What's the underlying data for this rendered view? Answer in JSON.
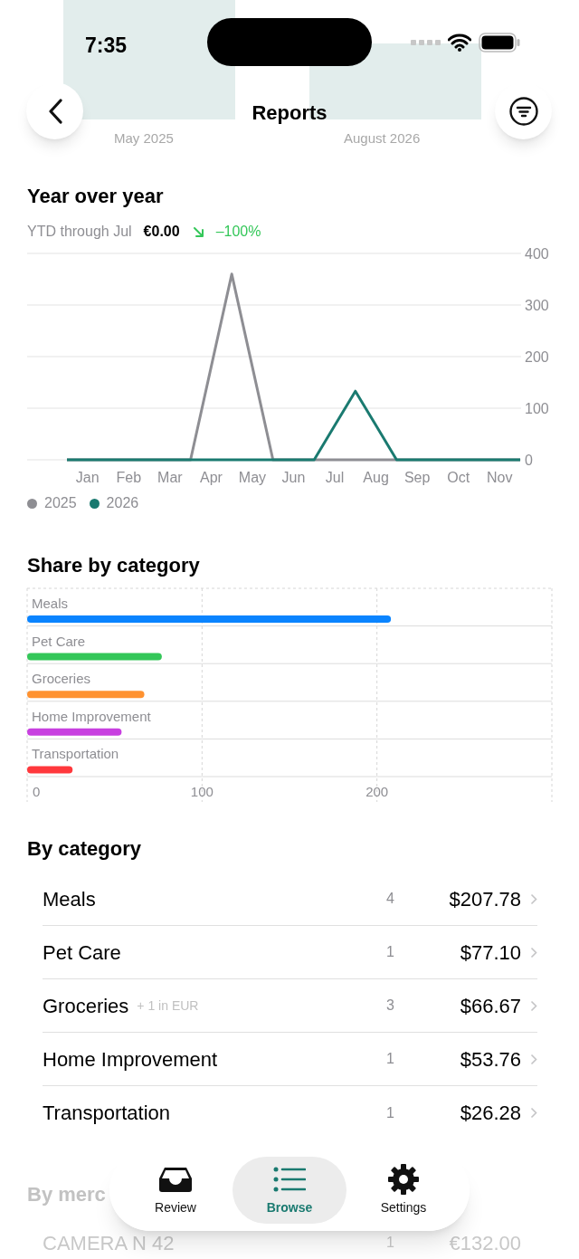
{
  "status_bar": {
    "time": "7:35"
  },
  "background_chart_labels": [
    "May 2025",
    "August 2026"
  ],
  "nav": {
    "title": "Reports"
  },
  "year_over_year": {
    "title": "Year over year",
    "summary_label": "YTD through Jul",
    "summary_value": "€0.00",
    "change": "–100%",
    "chart_data": {
      "type": "line",
      "grid": true,
      "categories": [
        null,
        "Jan",
        null,
        "Feb",
        null,
        "Mar",
        null,
        "Apr",
        null,
        "May",
        null,
        "Jun",
        null,
        "Jul",
        null,
        "Aug",
        null,
        "Sep",
        null,
        "Oct",
        null,
        "Nov",
        null
      ],
      "yticks": [
        0,
        100,
        200,
        300,
        400
      ],
      "ylim": [
        0,
        400
      ],
      "series": [
        {
          "name": "2025",
          "color": "#8e8e93",
          "values": [
            0,
            0,
            0,
            0,
            0,
            0,
            0,
            180,
            360,
            180,
            0,
            0,
            0,
            0,
            0,
            0,
            0,
            0,
            0,
            0,
            0,
            0,
            0
          ]
        },
        {
          "name": "2026",
          "color": "#1a7a70",
          "values": [
            0,
            0,
            0,
            0,
            0,
            0,
            0,
            0,
            0,
            0,
            0,
            0,
            0,
            66.5,
            133,
            66.5,
            0,
            0,
            0,
            0,
            0,
            0,
            0
          ]
        }
      ]
    }
  },
  "share_by_category": {
    "title": "Share by category",
    "chart_data": {
      "type": "bar",
      "orientation": "horizontal",
      "categories": [
        "Meals",
        "Pet Care",
        "Groceries",
        "Home Improvement",
        "Transportation"
      ],
      "xticks": [
        0,
        100,
        200
      ],
      "xlim": [
        0,
        300
      ],
      "series": [
        {
          "color": "#0a84ff",
          "values": [
            208,
            null,
            null,
            null,
            null
          ]
        },
        {
          "color": "#34c759",
          "values": [
            null,
            77,
            null,
            null,
            null
          ]
        },
        {
          "color": "#ff9230",
          "values": [
            null,
            null,
            67,
            null,
            null
          ]
        },
        {
          "color": "#c840e0",
          "values": [
            null,
            null,
            null,
            54,
            null
          ]
        },
        {
          "color": "#ff383c",
          "values": [
            null,
            null,
            null,
            null,
            26
          ]
        }
      ]
    }
  },
  "by_category": {
    "title": "By category",
    "rows": [
      {
        "name": "Meals",
        "count": "4",
        "amount": "$207.78"
      },
      {
        "name": "Pet Care",
        "count": "1",
        "amount": "$77.10"
      },
      {
        "name": "Groceries",
        "note": "+ 1 in EUR",
        "count": "3",
        "amount": "$66.67"
      },
      {
        "name": "Home Improvement",
        "count": "1",
        "amount": "$53.76"
      },
      {
        "name": "Transportation",
        "count": "1",
        "amount": "$26.28"
      }
    ]
  },
  "by_merchant": {
    "title": "By merc",
    "rows": [
      {
        "name": "CAMERA N 42",
        "count": "1",
        "amount": "€132.00"
      }
    ]
  },
  "tab_bar": [
    {
      "label": "Review",
      "selected": false
    },
    {
      "label": "Browse",
      "selected": true
    },
    {
      "label": "Settings",
      "selected": false
    }
  ]
}
